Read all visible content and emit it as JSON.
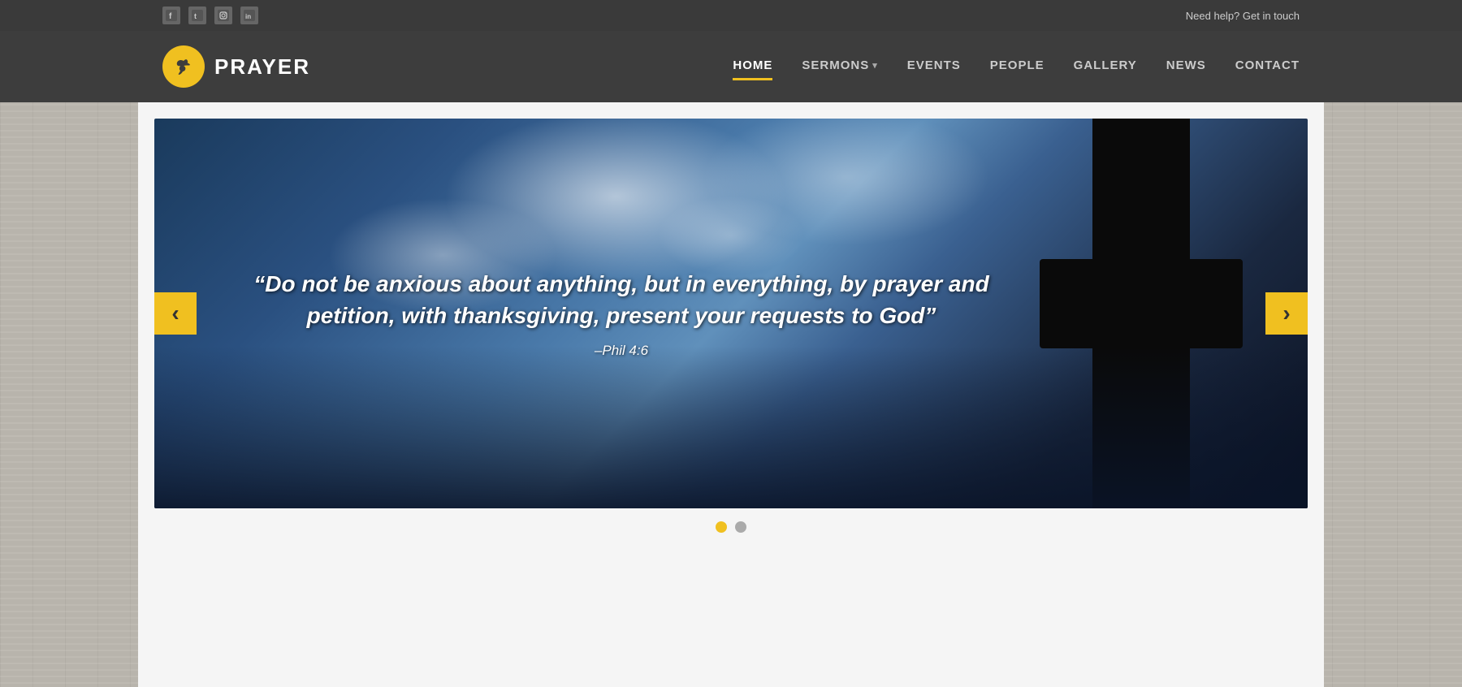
{
  "socialBar": {
    "helpText": "Need help? Get in touch",
    "icons": [
      {
        "name": "facebook",
        "label": "f"
      },
      {
        "name": "twitter",
        "label": "t"
      },
      {
        "name": "instagram",
        "label": "i"
      },
      {
        "name": "linkedin",
        "label": "in"
      }
    ]
  },
  "header": {
    "brandName": "PRAYER",
    "logoAlt": "Prayer church dove logo",
    "nav": [
      {
        "label": "HOME",
        "active": true,
        "hasDropdown": false
      },
      {
        "label": "SERMONS",
        "active": false,
        "hasDropdown": true
      },
      {
        "label": "EVENTS",
        "active": false,
        "hasDropdown": false
      },
      {
        "label": "PEOPLE",
        "active": false,
        "hasDropdown": false
      },
      {
        "label": "GALLERY",
        "active": false,
        "hasDropdown": false
      },
      {
        "label": "NEWS",
        "active": false,
        "hasDropdown": false
      },
      {
        "label": "CONTACT",
        "active": false,
        "hasDropdown": false
      }
    ]
  },
  "slider": {
    "quote": "“Do not be anxious about anything, but in everything, by prayer and petition, with thanksgiving, present your requests to God”",
    "reference": "–Phil 4:6",
    "prevArrow": "‹",
    "nextArrow": "›",
    "dots": [
      {
        "active": true
      },
      {
        "active": false
      }
    ]
  },
  "colors": {
    "accent": "#f0c020",
    "navBg": "#3d3d3d",
    "socialBg": "#3a3a3a",
    "crossColor": "#0a0a0a"
  }
}
